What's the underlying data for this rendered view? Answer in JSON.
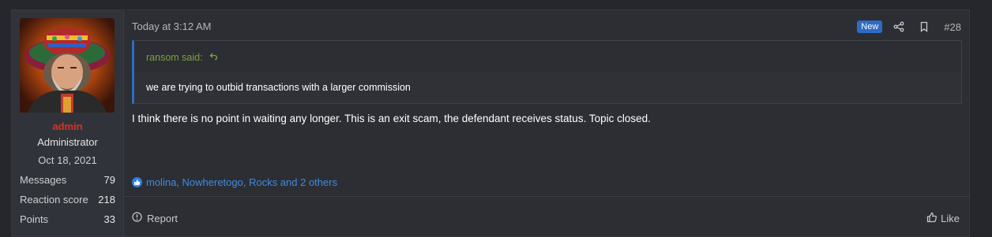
{
  "user": {
    "name": "admin",
    "title": "Administrator",
    "joined": "Oct 18, 2021",
    "stats": [
      {
        "label": "Messages",
        "value": "79"
      },
      {
        "label": "Reaction score",
        "value": "218"
      },
      {
        "label": "Points",
        "value": "33"
      }
    ],
    "name_color": "#e0301e"
  },
  "post": {
    "date": "Today at 3:12 AM",
    "badge": "New",
    "number": "#28",
    "quote": {
      "author": "ransom said:",
      "text": "we are trying to outbid transactions with a larger commission"
    },
    "message": "I think there is no point in waiting any longer. This is an exit scam, the defendant receives status. Topic closed.",
    "reactions": "molina, Nowheretogo, Rocks and 2 others",
    "report_label": "Report",
    "like_label": "Like"
  },
  "icons": {
    "share": "share-icon",
    "bookmark": "bookmark-icon",
    "reply": "reply-arrow-icon",
    "reaction": "thumbs-up-icon",
    "report": "info-circle-icon",
    "like": "thumbs-up-outline-icon"
  },
  "colors": {
    "accent": "#2f6bc4",
    "quote_author": "#7aa33a",
    "reaction_link": "#3f8be0"
  }
}
